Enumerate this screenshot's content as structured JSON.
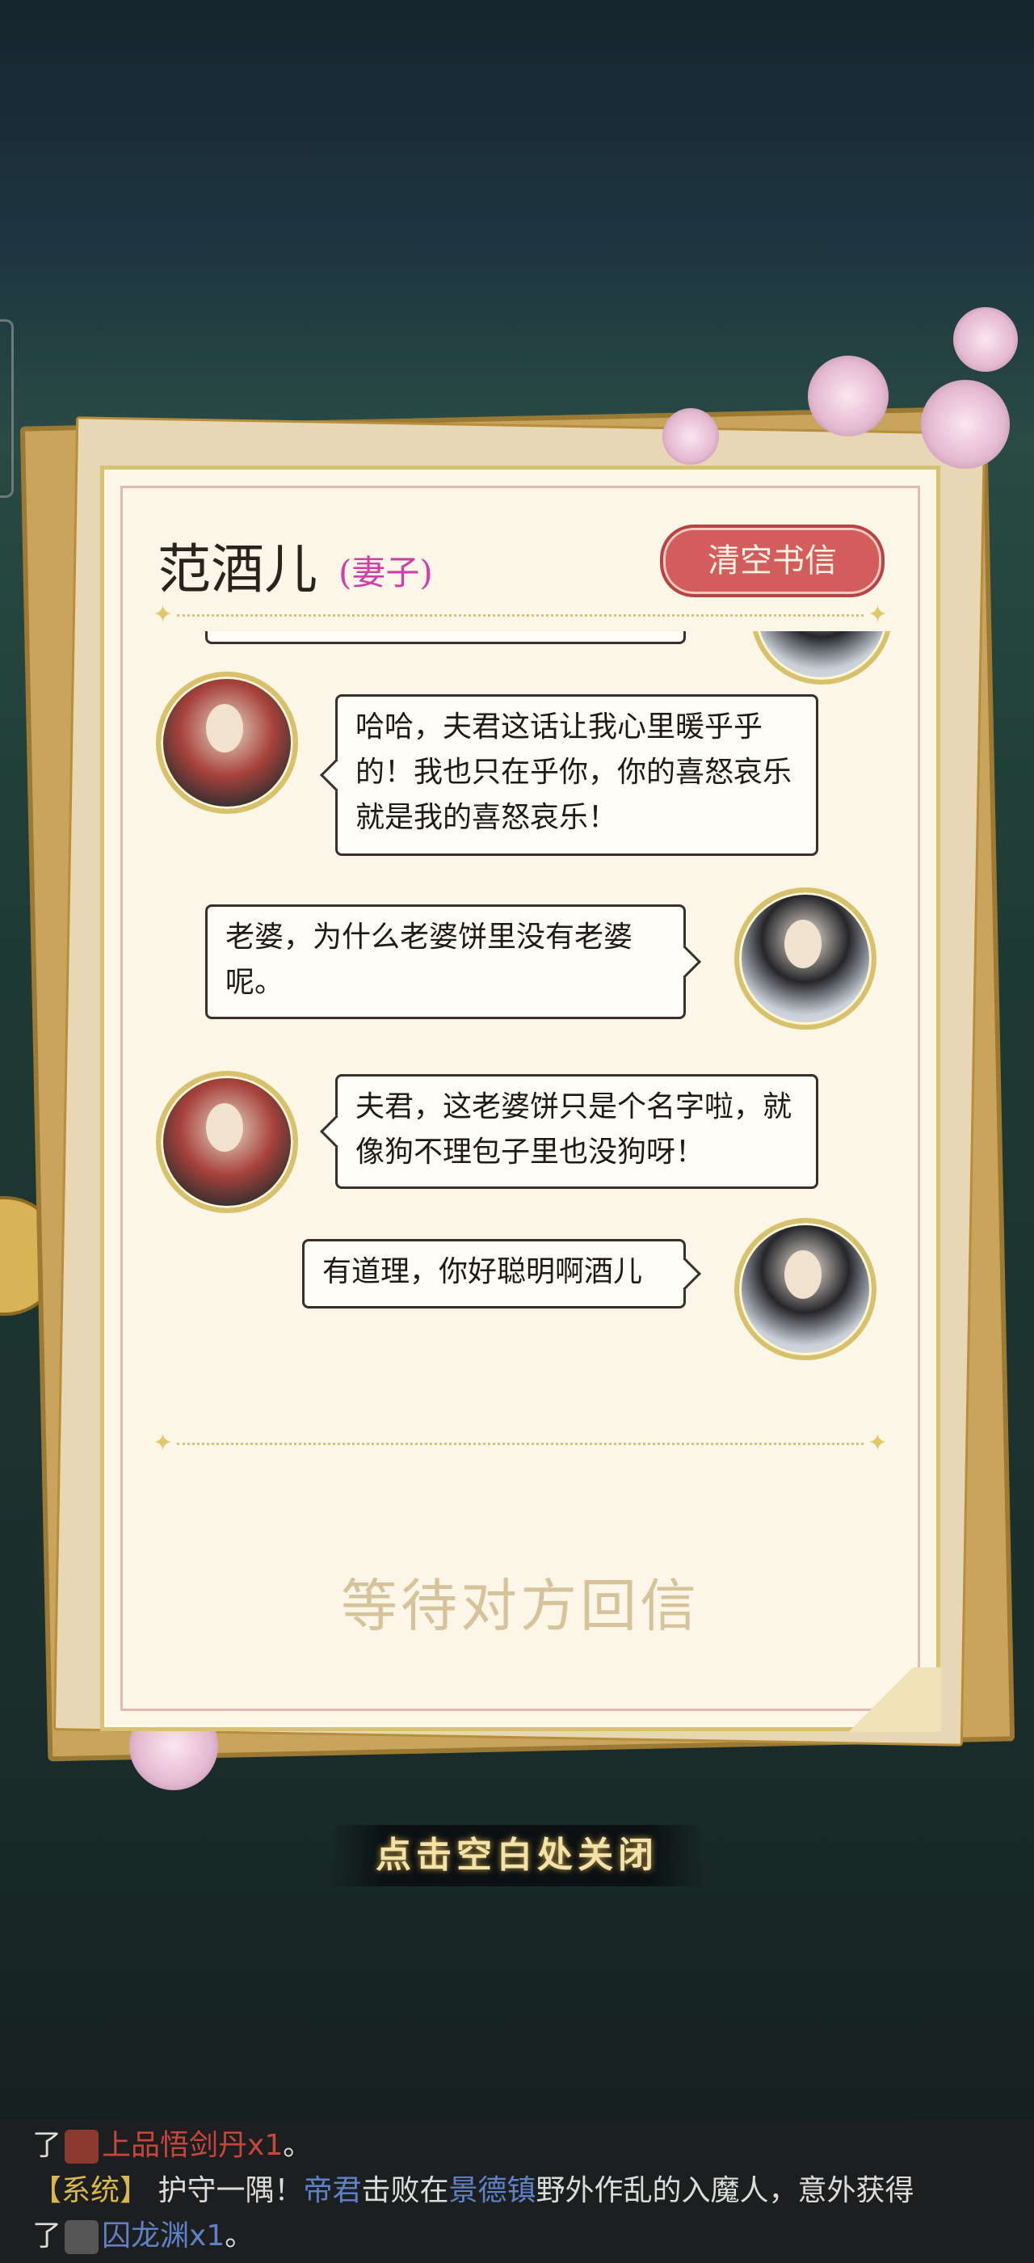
{
  "letter": {
    "name": "范酒儿",
    "relation": "(妻子)",
    "clear_button": "清空书信",
    "status": "等待对方回信"
  },
  "messages": [
    {
      "sender": "wife",
      "text": "哈哈，夫君这话让我心里暖乎乎的！我也只在乎你，你的喜怒哀乐就是我的喜怒哀乐！"
    },
    {
      "sender": "husband",
      "text": "老婆，为什么老婆饼里没有老婆呢。"
    },
    {
      "sender": "wife",
      "text": "夫君，这老婆饼只是个名字啦，就像狗不理包子里也没狗呀！"
    },
    {
      "sender": "husband",
      "text": "有道理，你好聪明啊酒儿"
    }
  ],
  "close_hint": "点击空白处关闭",
  "chat": {
    "line1": {
      "prefix": "了",
      "item": "上品悟剑丹x1",
      "suffix": "。"
    },
    "line2": {
      "tag": "【系统】",
      "t1": "护守一隅！",
      "player": "帝君",
      "t2": "击败在",
      "place": "景德镇",
      "t3": "野外作乱的入魔人，意外获得"
    },
    "line3": {
      "prefix": "了",
      "item": "囚龙渊x1",
      "suffix": "。"
    }
  },
  "colors": {
    "item_red": "#c9463d",
    "player_blue": "#5f82c6",
    "system_gold": "#d8b650",
    "relation_pink": "#d13ea5"
  }
}
